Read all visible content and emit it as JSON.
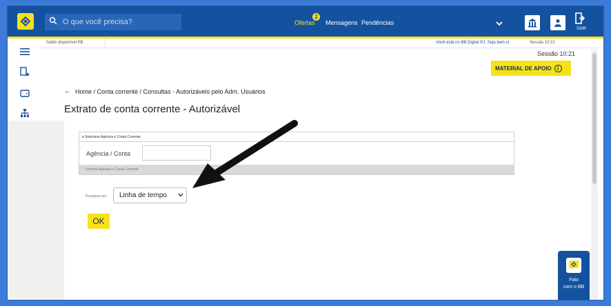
{
  "search": {
    "placeholder": "O que você precisa?"
  },
  "nav": {
    "ofertas": "Ofertas",
    "ofertas_badge": "2",
    "mensagens": "Mensagens",
    "pendencias": "Pendências"
  },
  "header": {
    "sair_label": "SAIR"
  },
  "subbar": {
    "saldo": "Saldo disponível  R$",
    "digital": "Você está no BB Digital PJ. Seja bem vi",
    "sessao": "Sessão 10:21"
  },
  "main": {
    "sessao": "Sessão 10:21",
    "material_apoio": "MATERIAL DE APOIO",
    "breadcrumb": "Home / Conta corrente / Consultas - Autorizáveis pelo Adm. Usuários",
    "title": "Extrato de conta corrente - Autorizável",
    "section_head": "▾ Selecione Agência e Conta Corrente",
    "agencia_label": "Agência / Conta",
    "agencia_value": "",
    "section_foot": "^ Informe Agência e Conta Corrente",
    "pesquisar_label": "Pesquisar por",
    "pesquisar_value": "Linha de tempo",
    "ok_label": "OK"
  },
  "falo": {
    "line1": "Falo",
    "line2": "com o BB"
  },
  "colors": {
    "brand_blue": "#1452a0",
    "brand_yellow": "#f6e21a"
  },
  "icons": [
    "menu-icon",
    "favorites-icon",
    "wallet-icon",
    "hierarchy-icon",
    "money-icon",
    "transfer-icon",
    "pix-icon",
    "cash-icon",
    "wallet2-icon",
    "document-check-icon",
    "document-icon",
    "shield-money-icon"
  ]
}
